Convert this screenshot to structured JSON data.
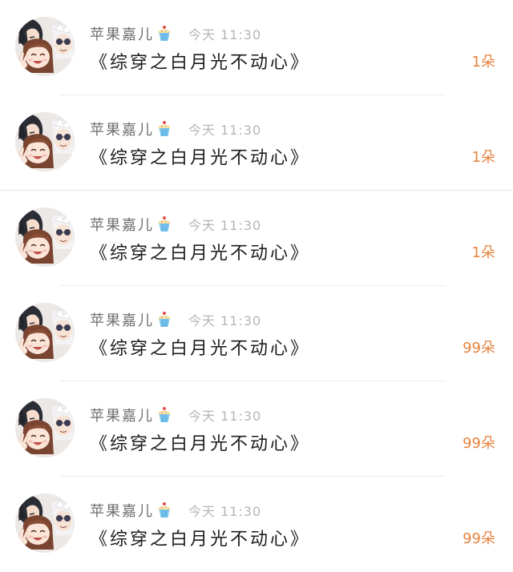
{
  "items": [
    {
      "name": "苹果嘉儿",
      "name_icon": "cupcake-icon",
      "time": "今天 11:30",
      "title": "《综穿之白月光不动心》",
      "count": "1朵"
    },
    {
      "name": "苹果嘉儿",
      "name_icon": "cupcake-icon",
      "time": "今天 11:30",
      "title": "《综穿之白月光不动心》",
      "count": "1朵"
    },
    {
      "name": "苹果嘉儿",
      "name_icon": "cupcake-icon",
      "time": "今天 11:30",
      "title": "《综穿之白月光不动心》",
      "count": "1朵"
    },
    {
      "name": "苹果嘉儿",
      "name_icon": "cupcake-icon",
      "time": "今天 11:30",
      "title": "《综穿之白月光不动心》",
      "count": "99朵"
    },
    {
      "name": "苹果嘉儿",
      "name_icon": "cupcake-icon",
      "time": "今天 11:30",
      "title": "《综穿之白月光不动心》",
      "count": "99朵"
    },
    {
      "name": "苹果嘉儿",
      "name_icon": "cupcake-icon",
      "time": "今天 11:30",
      "title": "《综穿之白月光不动心》",
      "count": "99朵"
    }
  ],
  "colors": {
    "count": "#e8823c",
    "name": "#6f6f6f",
    "time": "#b5b5b5",
    "title": "#1c1c1c"
  }
}
